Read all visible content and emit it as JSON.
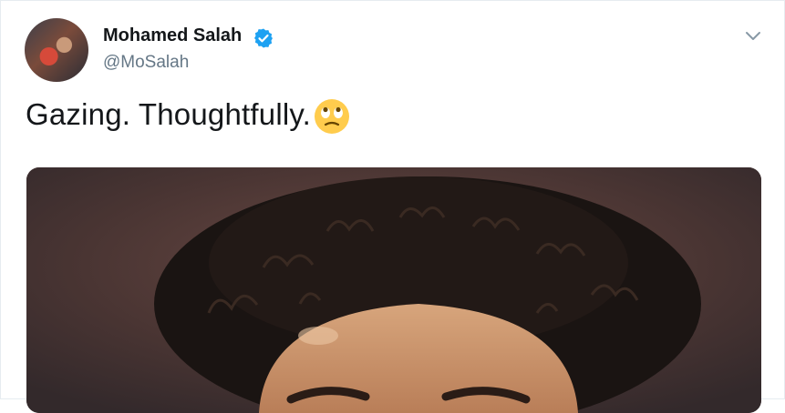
{
  "tweet": {
    "author_name": "Mohamed Salah",
    "author_handle": "@MoSalah",
    "text": "Gazing. Thoughtfully.",
    "emoji_icon": "face-with-rolling-eyes-icon"
  },
  "colors": {
    "name": "#14171a",
    "handle": "#657786",
    "verified": "#1da1f2",
    "border": "#e6ecf0"
  }
}
